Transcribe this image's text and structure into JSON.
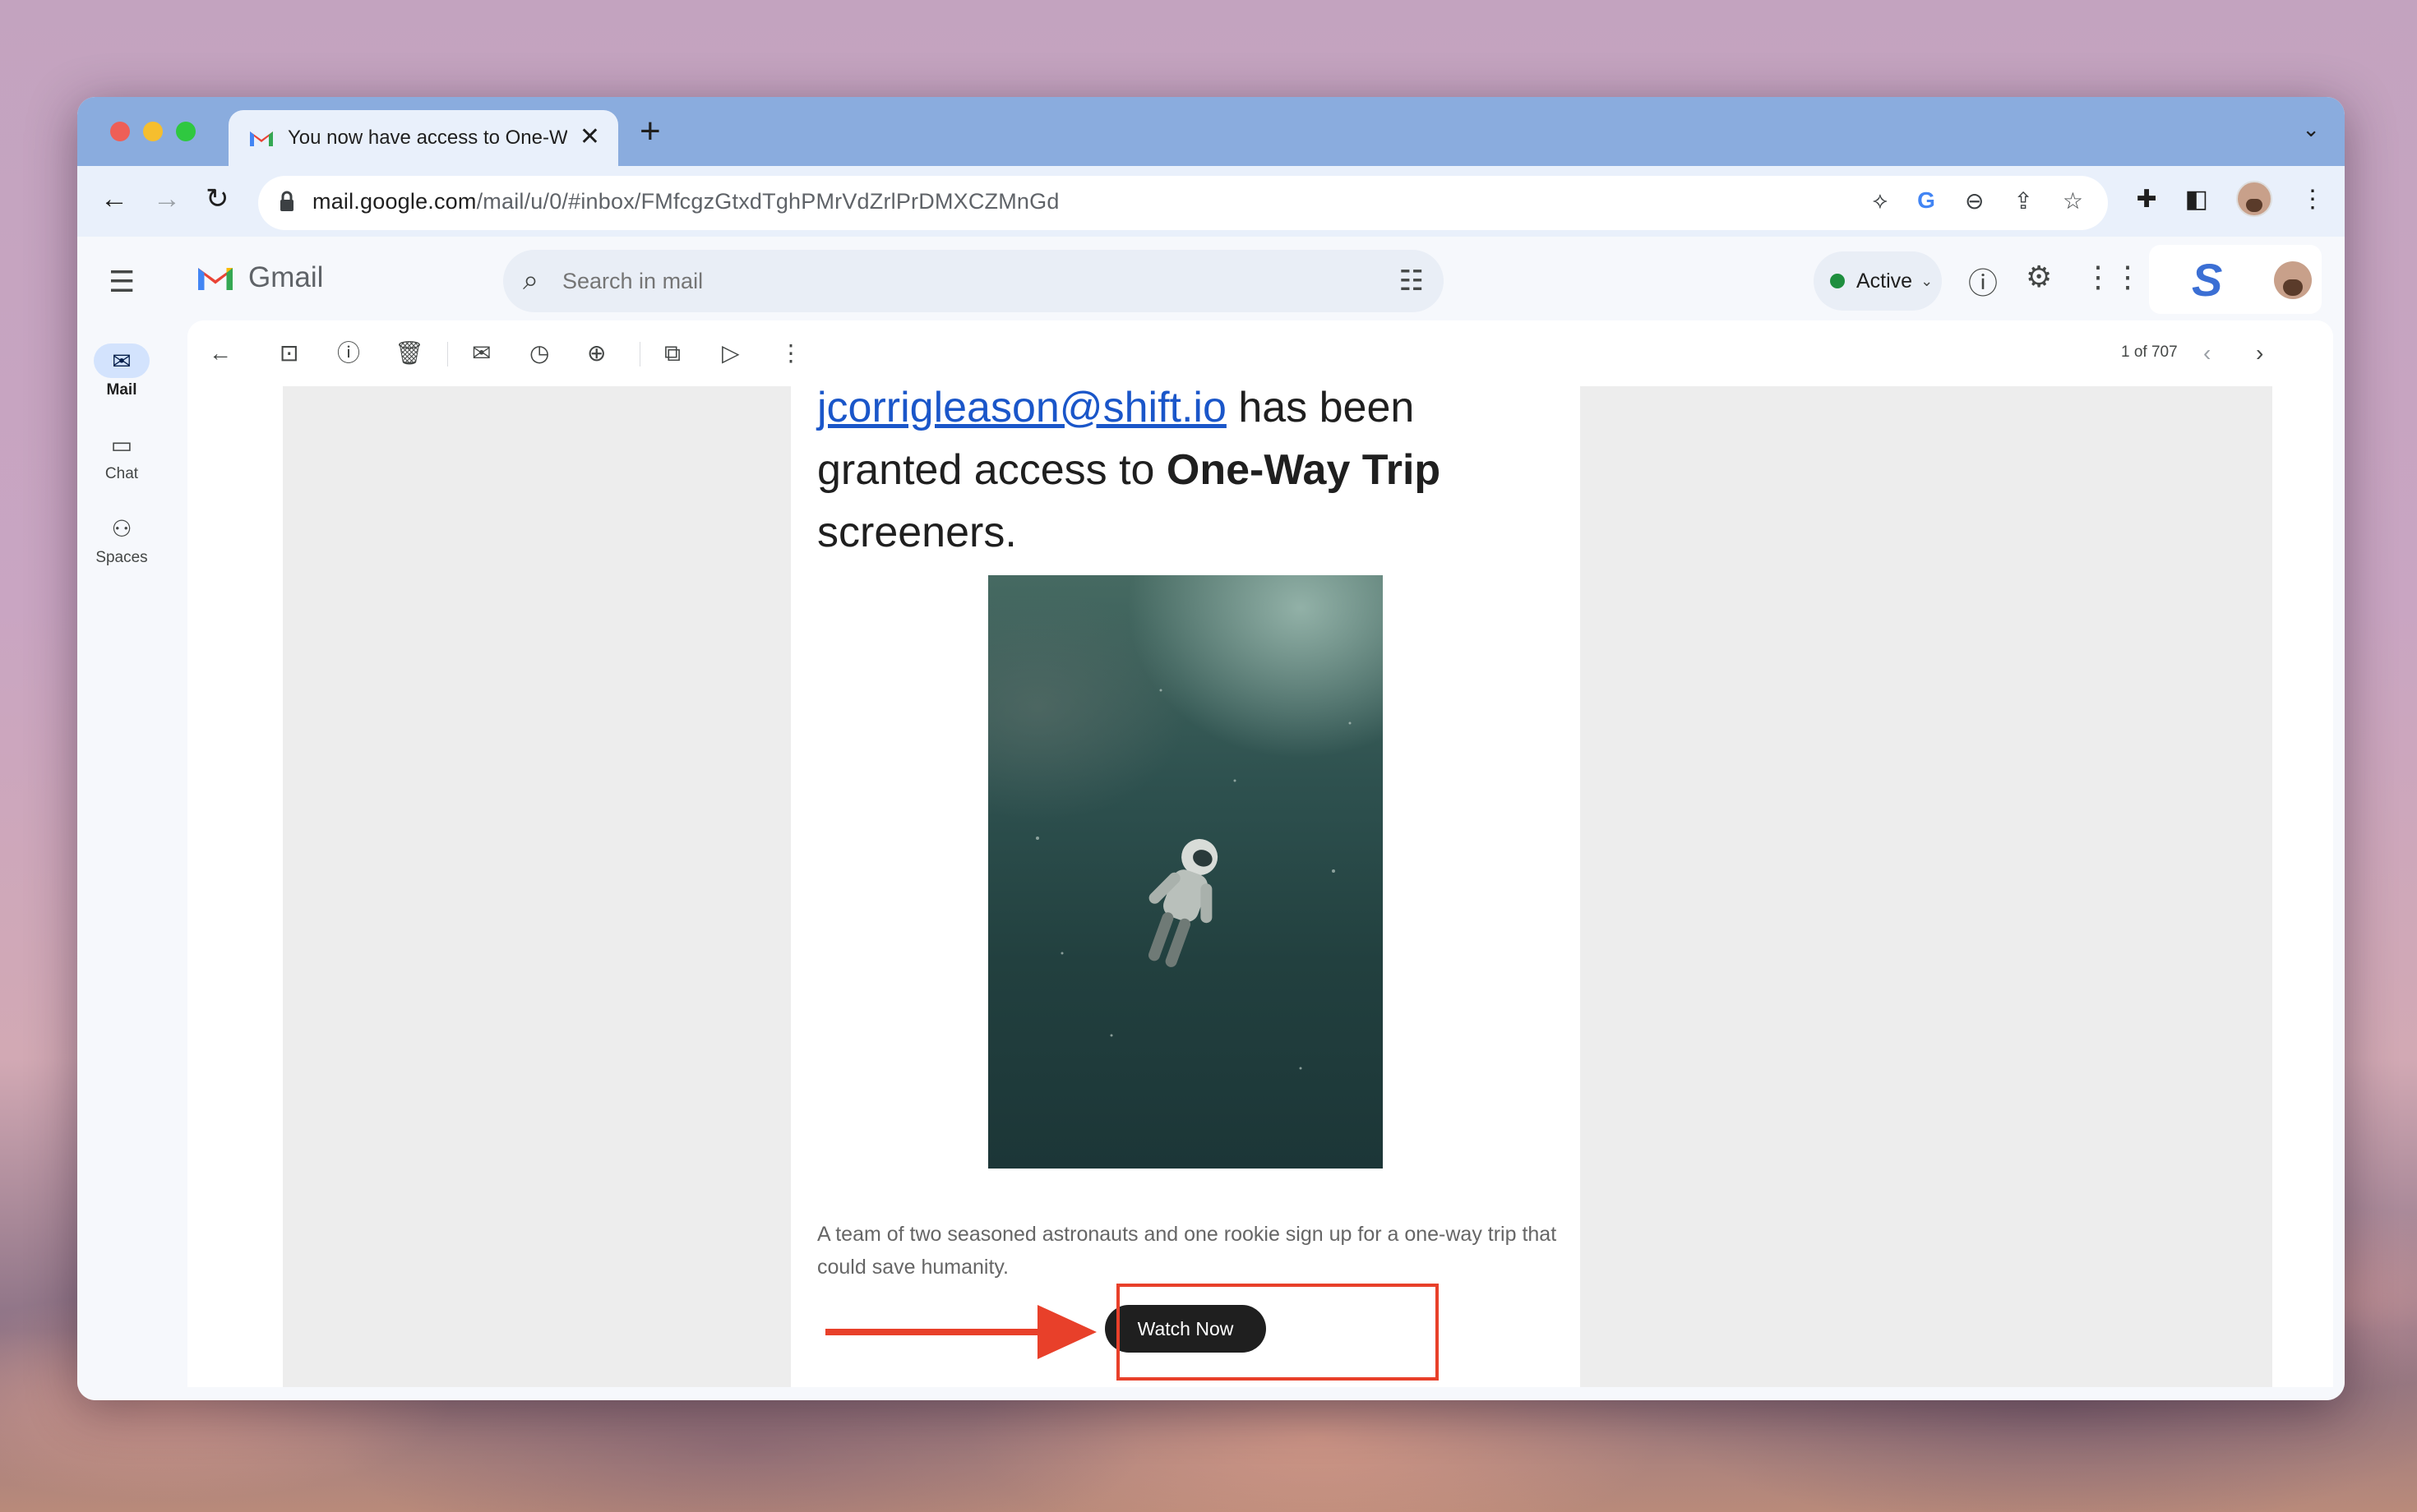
{
  "browser": {
    "tab_title": "You now have access to One-Way Trip screeners",
    "new_tab_symbol": "+",
    "url_host": "mail.google.com",
    "url_path": "/mail/u/0/#inbox/FMfcgzGtxdTghPMrVdZrlPrDMXCZMnGd"
  },
  "gmail": {
    "brand": "Gmail",
    "search": {
      "placeholder": "Search in mail",
      "value": ""
    },
    "status": "Active",
    "rail": [
      {
        "label": "Mail",
        "icon": "mail-icon"
      },
      {
        "label": "Chat",
        "icon": "chat-icon"
      },
      {
        "label": "Spaces",
        "icon": "spaces-icon"
      }
    ],
    "pager": "1 of 707"
  },
  "email": {
    "link_text": "jcorrigleason@shift.io",
    "line_after_link": " has been",
    "line2_prefix": "granted access to ",
    "line2_bold": "One-Way Trip",
    "line3": "screeners.",
    "caption": "A team of two seasoned astronauts and one rookie sign up for a one-way trip that could save humanity.",
    "cta_label": "Watch Now"
  },
  "colors": {
    "accent_blue": "#1a56c9",
    "annotation_red": "#e8402a",
    "active_green": "#1e8e3e",
    "tab_strip": "#8aacde"
  }
}
